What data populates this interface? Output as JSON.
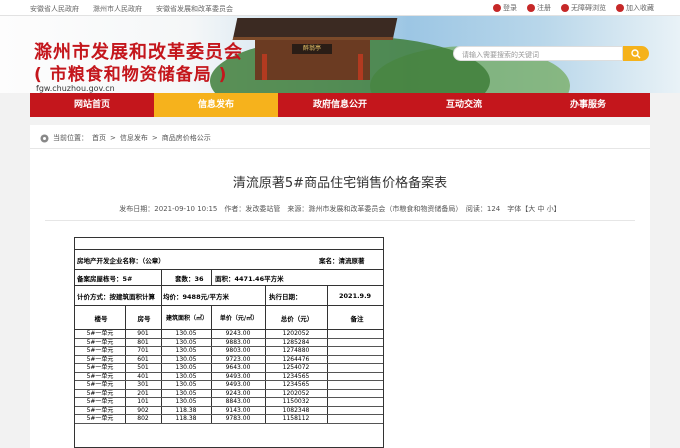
{
  "topbar": {
    "links": [
      "安徽省人民政府",
      "滁州市人民政府",
      "安徽省发展和改革委员会"
    ],
    "login": "登录",
    "register": "注册",
    "accessible": "无障碍浏览",
    "favorite": "加入收藏"
  },
  "header": {
    "title_line1": "滁州市发展和改革委员会",
    "title_line2": "( 市粮食和物资储备局 )",
    "domain": "fgw.chuzhou.gov.cn",
    "search_placeholder": "请输入需要搜索的关键词",
    "pavilion_sign": "醉翁亭"
  },
  "nav": [
    "网站首页",
    "信息发布",
    "政府信息公开",
    "互动交流",
    "办事服务"
  ],
  "breadcrumb": {
    "prefix": "当前位置：",
    "items": [
      "首页",
      "信息发布",
      "商品房价格公示"
    ]
  },
  "article": {
    "title": "清流原著5#商品住宅销售价格备案表",
    "meta": "发布日期：2021-09-10 10:15　作者：发改委站管　来源：滁州市发展和改革委员会（市粮食和物资储备局）　阅读：124　字体【大 中 小】"
  },
  "doc": {
    "developer_label": "房地产开发企业名称：（公章）",
    "project_label": "案名：清流原著",
    "building_label": "备案房屋栋号：5#",
    "units_label": "套数：36",
    "area_label": "面积：4471.46平方米",
    "method_label": "计价方式：按建筑面积计算",
    "avg_label": "均价：9488元/平方米",
    "date_label": "执行日期：",
    "date_value": "2021.9.9",
    "headers": [
      "楼号",
      "房号",
      "建筑面积（㎡）",
      "单价（元/㎡）",
      "总价（元）",
      "备注"
    ],
    "rows": [
      [
        "5#一单元",
        "901",
        "130.05",
        "9243.00",
        "1202052",
        ""
      ],
      [
        "5#一单元",
        "801",
        "130.05",
        "9883.00",
        "1285284",
        ""
      ],
      [
        "5#一单元",
        "701",
        "130.05",
        "9803.00",
        "1274880",
        ""
      ],
      [
        "5#一单元",
        "601",
        "130.05",
        "9723.00",
        "1264476",
        ""
      ],
      [
        "5#一单元",
        "501",
        "130.05",
        "9643.00",
        "1254072",
        ""
      ],
      [
        "5#一单元",
        "401",
        "130.05",
        "9493.00",
        "1234565",
        ""
      ],
      [
        "5#一单元",
        "301",
        "130.05",
        "9493.00",
        "1234565",
        ""
      ],
      [
        "5#一单元",
        "201",
        "130.05",
        "9243.00",
        "1202052",
        ""
      ],
      [
        "5#一单元",
        "101",
        "130.05",
        "8843.00",
        "1150032",
        ""
      ],
      [
        "5#一单元",
        "902",
        "118.38",
        "9143.00",
        "1082348",
        ""
      ],
      [
        "5#一单元",
        "802",
        "118.38",
        "9783.00",
        "1158112",
        ""
      ]
    ]
  }
}
